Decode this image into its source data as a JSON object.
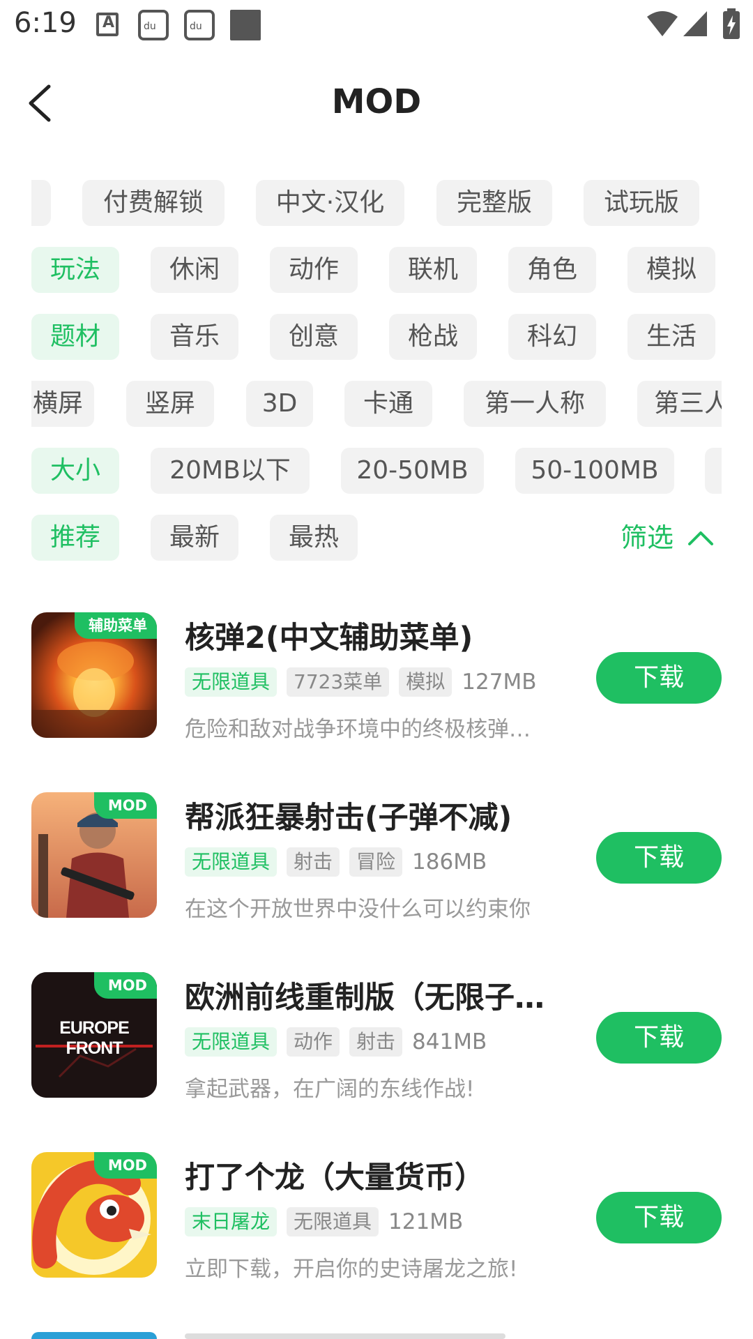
{
  "status_bar": {
    "time": "6:19",
    "a_icon_letter": "A",
    "du_text": "du"
  },
  "header": {
    "title": "MOD"
  },
  "filters": {
    "row1": [
      "付费解锁",
      "中文·汉化",
      "完整版",
      "试玩版"
    ],
    "row2": {
      "label": "玩法",
      "chips": [
        "休闲",
        "动作",
        "联机",
        "角色",
        "模拟"
      ]
    },
    "row3": {
      "label": "题材",
      "chips": [
        "音乐",
        "创意",
        "枪战",
        "科幻",
        "生活"
      ]
    },
    "row4": [
      "横屏",
      "竖屏",
      "3D",
      "卡通",
      "第一人称",
      "第三人"
    ],
    "row5": {
      "label": "大小",
      "chips": [
        "20MB以下",
        "20-50MB",
        "50-100MB"
      ]
    },
    "row6": {
      "label": "推荐",
      "chips": [
        "最新",
        "最热"
      ]
    },
    "filter_label": "筛选"
  },
  "apps": [
    {
      "badge": "辅助菜单",
      "title": "核弹2(中文辅助菜单)",
      "tags": [
        "无限道具",
        "7723菜单",
        "模拟"
      ],
      "size": "127MB",
      "desc": "危险和敌对战争环境中的终极核弹…",
      "button": "下载"
    },
    {
      "badge": "MOD",
      "title": "帮派狂暴射击(子弹不减)",
      "tags": [
        "无限道具",
        "射击",
        "冒险"
      ],
      "size": "186MB",
      "desc": "在这个开放世界中没什么可以约束你",
      "button": "下载"
    },
    {
      "badge": "MOD",
      "title": "欧洲前线重制版（无限子…",
      "icon_text": "EUROPE FRONT",
      "tags": [
        "无限道具",
        "动作",
        "射击"
      ],
      "size": "841MB",
      "desc": "拿起武器，在广阔的东线作战!",
      "button": "下载"
    },
    {
      "badge": "MOD",
      "title": "打了个龙（大量货币）",
      "tags": [
        "末日屠龙",
        "无限道具"
      ],
      "size": "121MB",
      "desc": "立即下载，开启你的史诗屠龙之旅!",
      "button": "下载"
    }
  ],
  "colors": {
    "accent": "#1fbf62",
    "chip_bg": "#f2f2f2",
    "label_bg": "#e8f8ee"
  }
}
